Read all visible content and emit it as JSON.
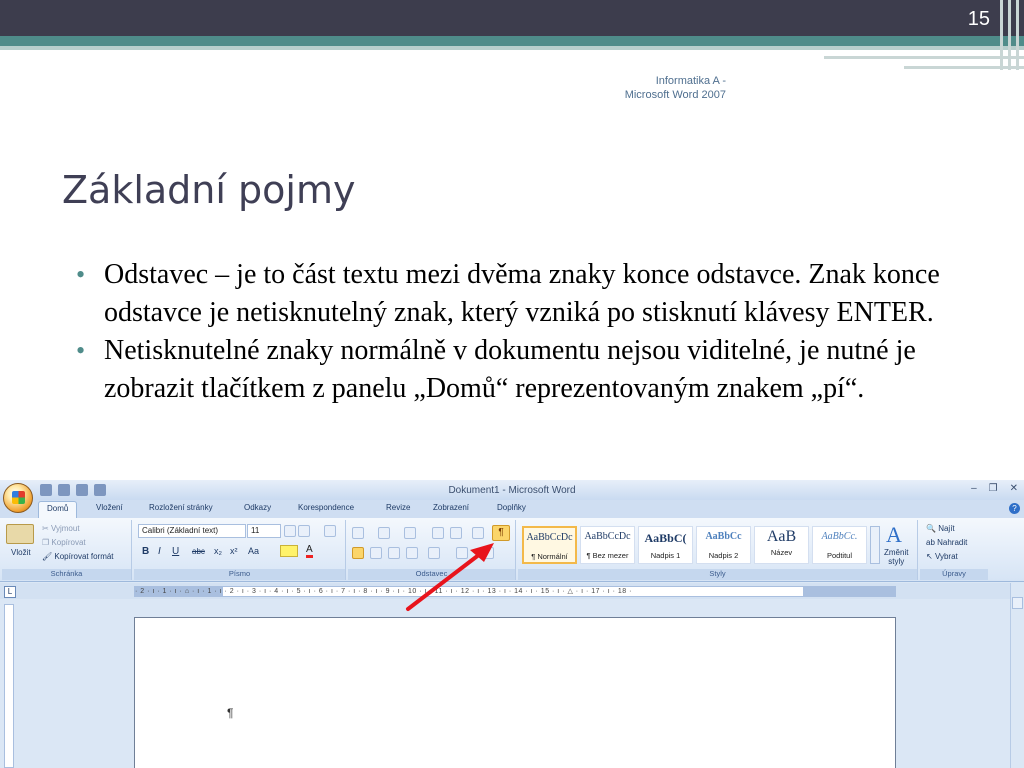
{
  "slide": {
    "number": "15",
    "course_line1": "Informatika A -",
    "course_line2": "Microsoft Word 2007",
    "title": "Základní pojmy",
    "bullets": [
      "Odstavec – je to část textu mezi dvěma znaky konce odstavce. Znak konce odstavce je netisknutelný znak, který vzniká po stisknutí klávesy ENTER.",
      "Netisknutelné znaky normálně v dokumentu nejsou viditelné, je nutné je zobrazit tlačítkem z panelu „Domů“ reprezentovaným znakem „pí“."
    ],
    "colors": {
      "top_bar": "#3d3d4d",
      "accent": "#4f8c8a",
      "title": "#3f3f55",
      "arrow": "#e8141c"
    }
  },
  "word": {
    "window_title": "Dokument1 - Microsoft Word",
    "tabs": [
      "Domů",
      "Vložení",
      "Rozložení stránky",
      "Odkazy",
      "Korespondence",
      "Revize",
      "Zobrazení",
      "Doplňky"
    ],
    "clipboard": {
      "label": "Schránka",
      "paste": "Vložit",
      "cut": "Vyjmout",
      "copy": "Kopírovat",
      "format_painter": "Kopírovat formát"
    },
    "font": {
      "label": "Písmo",
      "name": "Calibri (Základní text)",
      "size": "11"
    },
    "paragraph": {
      "label": "Odstavec",
      "show_marks": "¶"
    },
    "styles": {
      "label": "Styly",
      "items": [
        {
          "sample": "AaBbCcDc",
          "name": "¶ Normální"
        },
        {
          "sample": "AaBbCcDc",
          "name": "¶ Bez mezer"
        },
        {
          "sample": "AaBbC(",
          "name": "Nadpis 1"
        },
        {
          "sample": "AaBbCc",
          "name": "Nadpis 2"
        },
        {
          "sample": "AaB",
          "name": "Název"
        },
        {
          "sample": "AaBbCc.",
          "name": "Podtitul"
        }
      ],
      "change_styles_1": "Změnit",
      "change_styles_2": "styly"
    },
    "editing": {
      "label": "Úpravy",
      "find": "Najít",
      "replace": "Nahradit",
      "select": "Vybrat"
    },
    "ruler_text": "· 2 · ı · 1 · ı · ⌂ · ı · 1 · ı · 2 · ı · 3 · ı · 4 · ı · 5 · ı · 6 · ı · 7 · ı · 8 · ı · 9 · ı · 10 · ı · 11 · ı · 12 · ı · 13 · ı · 14 · ı · 15 · ı · △ · ı · 17 · ı · 18 ·",
    "document_mark": "¶"
  }
}
